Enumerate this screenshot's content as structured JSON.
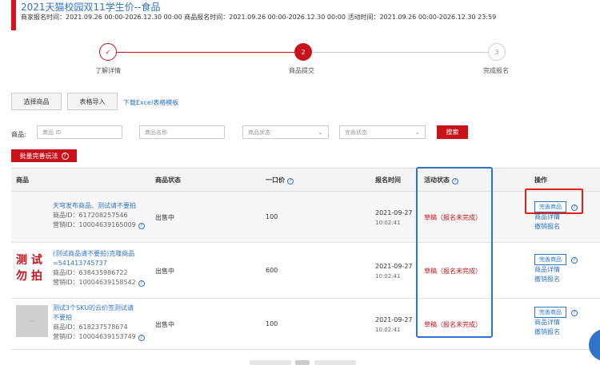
{
  "header": {
    "title": "2021天猫校园双11学生价--食品",
    "subtitle": "商家报名时间：2021.09.26 00:00-2026.12.30 00:00   商品报名时间：2021.09.26 00:00-2026.12.30 00:00   活动时间：2021.09.26 00:00-2026.12.30 23:59"
  },
  "steps": [
    {
      "label": "了解详情",
      "number": "✓",
      "state": "done"
    },
    {
      "label": "商品提交",
      "number": "2",
      "state": "active"
    },
    {
      "label": "完成报名",
      "number": "3",
      "state": "pending"
    }
  ],
  "toolbar": {
    "select_goods": "选择商品",
    "table_import": "表格导入",
    "download_template": "下载Excel表格模板"
  },
  "filter": {
    "label": "商品:",
    "product_id_placeholder": "商品 ID",
    "product_name_placeholder": "商品名称",
    "product_status_placeholder": "商品状态",
    "completion_status_placeholder": "完善状态",
    "search_label": "搜索"
  },
  "batch_button": "批量完善玩法",
  "table": {
    "headers": {
      "product": "商品",
      "product_status": "商品状态",
      "price": "一口价",
      "signup_time": "报名时间",
      "activity_status": "活动状态",
      "operation": "操作"
    },
    "rows": [
      {
        "name_line1": "天穹发布商品、测试请不要拍",
        "name_line2": "",
        "product_id": "商品ID：617208257546",
        "marketing_id": "营销ID：10004639165009",
        "status": "出售中",
        "price": "100",
        "date": "2021-09-27",
        "time": "10:02:41",
        "activity_status": "草稿（报名未完成）",
        "op_primary": "完善商品",
        "op_detail": "商品详情",
        "op_cancel": "撤销报名"
      },
      {
        "name_line1": "(测试商品请不要拍)克隆商品",
        "name_line2": "=541413745737",
        "product_id": "商品ID：638435986722",
        "marketing_id": "营销ID：10004639158542",
        "status": "出售中",
        "price": "600",
        "date": "2021-09-27",
        "time": "10:02:41",
        "activity_status": "草稿（报名未完成）",
        "op_primary": "完善商品",
        "op_detail": "商品详情",
        "op_cancel": "撤销报名",
        "thumb_text_1": "测 试",
        "thumb_text_2": "勿 拍"
      },
      {
        "name_line1": "测试3个SKU的云价签测试请",
        "name_line2": "不要拍",
        "product_id": "商品ID：618237578674",
        "marketing_id": "营销ID：10004639153749",
        "status": "出售中",
        "price": "100",
        "date": "2021-09-27",
        "time": "10:02:41",
        "activity_status": "草稿（报名未完成）",
        "op_primary": "完善商品",
        "op_detail": "商品详情",
        "op_cancel": "撤销报名"
      }
    ]
  },
  "colors": {
    "accent": "#c9131b",
    "link": "#2e74c8"
  }
}
